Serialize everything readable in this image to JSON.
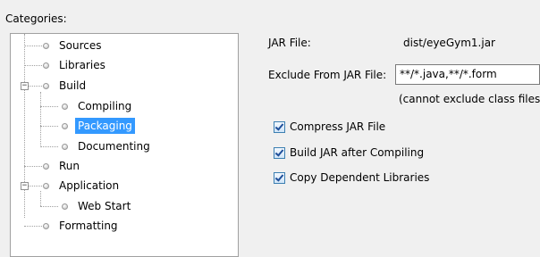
{
  "categories_label": "Categories:",
  "tree": {
    "items": [
      {
        "label": "Sources"
      },
      {
        "label": "Libraries"
      },
      {
        "label": "Build"
      },
      {
        "label": "Compiling"
      },
      {
        "label": "Packaging",
        "selected": true
      },
      {
        "label": "Documenting"
      },
      {
        "label": "Run"
      },
      {
        "label": "Application"
      },
      {
        "label": "Web Start"
      },
      {
        "label": "Formatting"
      }
    ],
    "expander_minus": "−"
  },
  "form": {
    "jar_file_label": "JAR File:",
    "jar_file_value": "dist/eyeGym1.jar",
    "exclude_label": "Exclude From JAR File:",
    "exclude_value": "**/*.java,**/*.form",
    "exclude_note": "(cannot exclude class files)",
    "checkboxes": [
      {
        "label": "Compress JAR File",
        "checked": true
      },
      {
        "label": "Build JAR after Compiling",
        "checked": true
      },
      {
        "label": "Copy Dependent Libraries",
        "checked": true
      }
    ]
  }
}
